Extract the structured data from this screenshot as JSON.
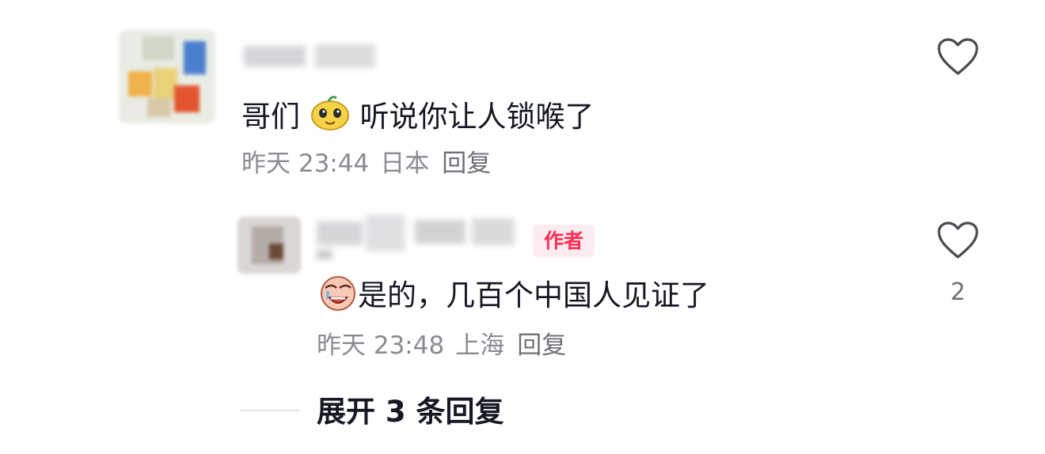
{
  "comments": [
    {
      "text_before_emoji": "哥们",
      "emoji": "sticker-face-icon",
      "text_after_emoji": "听说你让人锁喉了",
      "time": "昨天 23:44",
      "location": "日本",
      "reply_label": "回复"
    }
  ],
  "reply": {
    "badge": "作者",
    "emoji": "crying-face-icon",
    "text": "是的，几百个中国人见证了",
    "time": "昨天 23:48",
    "location": "上海",
    "reply_label": "回复",
    "like_count": "2"
  },
  "expand_label": "展开 3 条回复",
  "colors": {
    "badge_text": "#fe2c55",
    "badge_bg": "#fdecef",
    "meta_text": "#8a8b91"
  }
}
